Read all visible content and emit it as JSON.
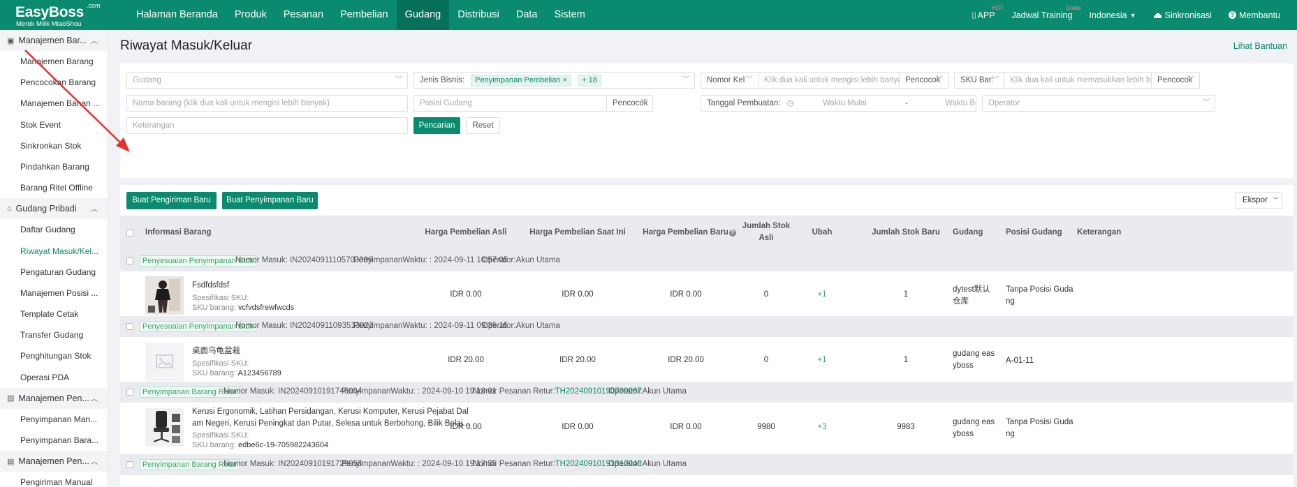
{
  "topbar": {
    "logo": {
      "brand": "EasyBoss",
      "com": ".com",
      "sub": "Merek Milik MiaoShou"
    },
    "nav": [
      "Halaman Beranda",
      "Produk",
      "Pesanan",
      "Pembelian",
      "Gudang",
      "Distribusi",
      "Data",
      "Sistem"
    ],
    "active_nav": "Gudang",
    "right": {
      "app": "APP",
      "app_badge": "HOT",
      "training": "Jadwal Training",
      "training_badge": "Gratis",
      "language": "Indonesia",
      "sync": "Sinkronisasi",
      "help": "Membantu"
    }
  },
  "sidebar": {
    "groups": [
      {
        "label": "Manajemen Bar...",
        "icon": "box-icon",
        "items": [
          "Manajemen Barang",
          "Pencocokan Barang",
          "Manajemen Bahan ...",
          "Stok Event",
          "Sinkronkan Stok",
          "Pindahkan Barang",
          "Barang Ritel Offline"
        ]
      },
      {
        "label": "Gudang Pribadi",
        "icon": "warehouse-icon",
        "items": [
          "Daftar Gudang",
          "Riwayat Masuk/Kel...",
          "Pengaturan Gudang",
          "Manajemen Posisi ...",
          "Template Cetak",
          "Transfer Gudang",
          "Penghitungan Stok",
          "Operasi PDA"
        ]
      },
      {
        "label": "Manajemen Pen...",
        "icon": "inbound-icon",
        "items": [
          "Penyimpanan Man...",
          "Penyimpanan Bara..."
        ]
      },
      {
        "label": "Manajemen Pen...",
        "icon": "outbound-icon",
        "items": [
          "Pengiriman Manual"
        ]
      }
    ],
    "active_item": "Riwayat Masuk/Kel..."
  },
  "page": {
    "title": "Riwayat Masuk/Keluar",
    "help_link": "Lihat Bantuan"
  },
  "filters": {
    "gudang_placeholder": "Gudang",
    "jenis_label": "Jenis Bisnis:",
    "jenis_tag": "Penyimpanan Pembelian",
    "jenis_tag_close": "×",
    "jenis_more": "+ 18",
    "nomor_select": "Nomor Kel",
    "nomor_placeholder": "Klik dua kali untuk mengisi lebih banyak",
    "match1": "Pencocok",
    "sku_select": "SKU Bar:",
    "sku_placeholder": "Klik dua kali untuk memasukkan lebih banya",
    "match2": "Pencocok",
    "nama_placeholder": "Nama barang (klik dua kali untuk mengisi lebih banyak)",
    "posisi_placeholder": "Posisi Gudang",
    "match3": "Pencocok",
    "tanggal_label": "Tanggal Pembuatan:",
    "start_placeholder": "Waktu Mulai",
    "range_sep": "-",
    "end_placeholder": "Waktu Berakhir",
    "operator_placeholder": "Operator",
    "keterangan_placeholder": "Keterangan",
    "search_btn": "Pencarian",
    "reset_btn": "Reset"
  },
  "actions": {
    "new_shipment": "Buat Pengiriman Baru",
    "new_storage": "Buat Penyimpanan Baru",
    "export": "Ekspor"
  },
  "table": {
    "headers": {
      "info": "Informasi Barang",
      "harga_asli": "Harga Pembelian Asli",
      "harga_kini": "Harga Pembelian Saat Ini",
      "harga_baru": "Harga Pembelian Baru",
      "stok_asli_1": "Jumlah Stok",
      "stok_asli_2": "Asli",
      "ubah": "Ubah",
      "stok_baru": "Jumlah Stok Baru",
      "gudang": "Gudang",
      "posisi": "Posisi Gudang",
      "keterangan": "Keterangan"
    },
    "records": [
      {
        "type": "Penyesuaian Penyimpanan Stok",
        "nomor": "Nomor Masuk: IN20240911105703096",
        "waktu": "PenyimpananWaktu: : 2024-09-11 10:57:05",
        "retur_label": "",
        "retur_no": "",
        "operator": "Operator:Akun Utama",
        "name": "Fsdfdsfdsf",
        "spec": "Spesifikasi SKU:",
        "sku_label": "SKU barang:",
        "sku": "vcfvdsfrewfwcds",
        "harga_asli": "IDR 0.00",
        "harga_kini": "IDR 0.00",
        "harga_baru": "IDR 0.00",
        "stok_asli": "0",
        "ubah": "+1",
        "stok_baru": "1",
        "gudang": "dytest默认\n仓库",
        "posisi": "Tanpa Posisi Guda\nng"
      },
      {
        "type": "Penyesuaian Penyimpanan Stok",
        "nomor": "Nomor Masuk: IN20240911093513022",
        "waktu": "PenyimpananWaktu: : 2024-09-11 09:35:15",
        "retur_label": "",
        "retur_no": "",
        "operator": "Operator:Akun Utama",
        "name": "桌面乌龟盆栽",
        "spec": "Spesifikasi SKU:",
        "sku_label": "SKU barang:",
        "sku": "A123456789",
        "harga_asli": "IDR 20.00",
        "harga_kini": "IDR 20.00",
        "harga_baru": "IDR 20.00",
        "stok_asli": "0",
        "ubah": "+1",
        "stok_baru": "1",
        "gudang": "gudang eas\nyboss",
        "posisi": "A-01-11"
      },
      {
        "type": "Penyimpanan Barang Retur",
        "nomor": "Nomor Masuk: IN20240910191746004",
        "waktu": "PenyimpananWaktu: : 2024-09-10 19:18:01",
        "retur_label": "Nomor Pesanan Retur:",
        "retur_no": "TH20240910190709067",
        "operator": "Operator:Akun Utama",
        "name": "Kerusi Ergonomik, Latihan Persidangan, Kerusi Komputer, Kerusi Pejabat Dal\nam Negeri, Kerusi Peningkat dan Putar, Selesa untuk Berbohong, Bilik Belaj...",
        "spec": "Spesifikasi SKU:",
        "sku_label": "SKU barang:",
        "sku": "edbe6c-19-705982243604",
        "harga_asli": "IDR 0.00",
        "harga_kini": "IDR 0.00",
        "harga_baru": "IDR 0.00",
        "stok_asli": "9980",
        "ubah": "+3",
        "stok_baru": "9983",
        "gudang": "gudang eas\nyboss",
        "posisi": "Tanpa Posisi Guda\nng"
      },
      {
        "type": "Penyimpanan Barang Retur",
        "nomor": "Nomor Masuk: IN20240910191729058",
        "waktu": "PenyimpananWaktu: : 2024-09-10 19:17:35",
        "retur_label": "Nomor Pesanan Retur:",
        "retur_no": "TH20240910191317040",
        "operator": "Operator:Akun Utama"
      }
    ]
  },
  "colors": {
    "brand": "#0a8a6e",
    "arrow": "#e5322d",
    "tag_green": "#3aa76d"
  }
}
